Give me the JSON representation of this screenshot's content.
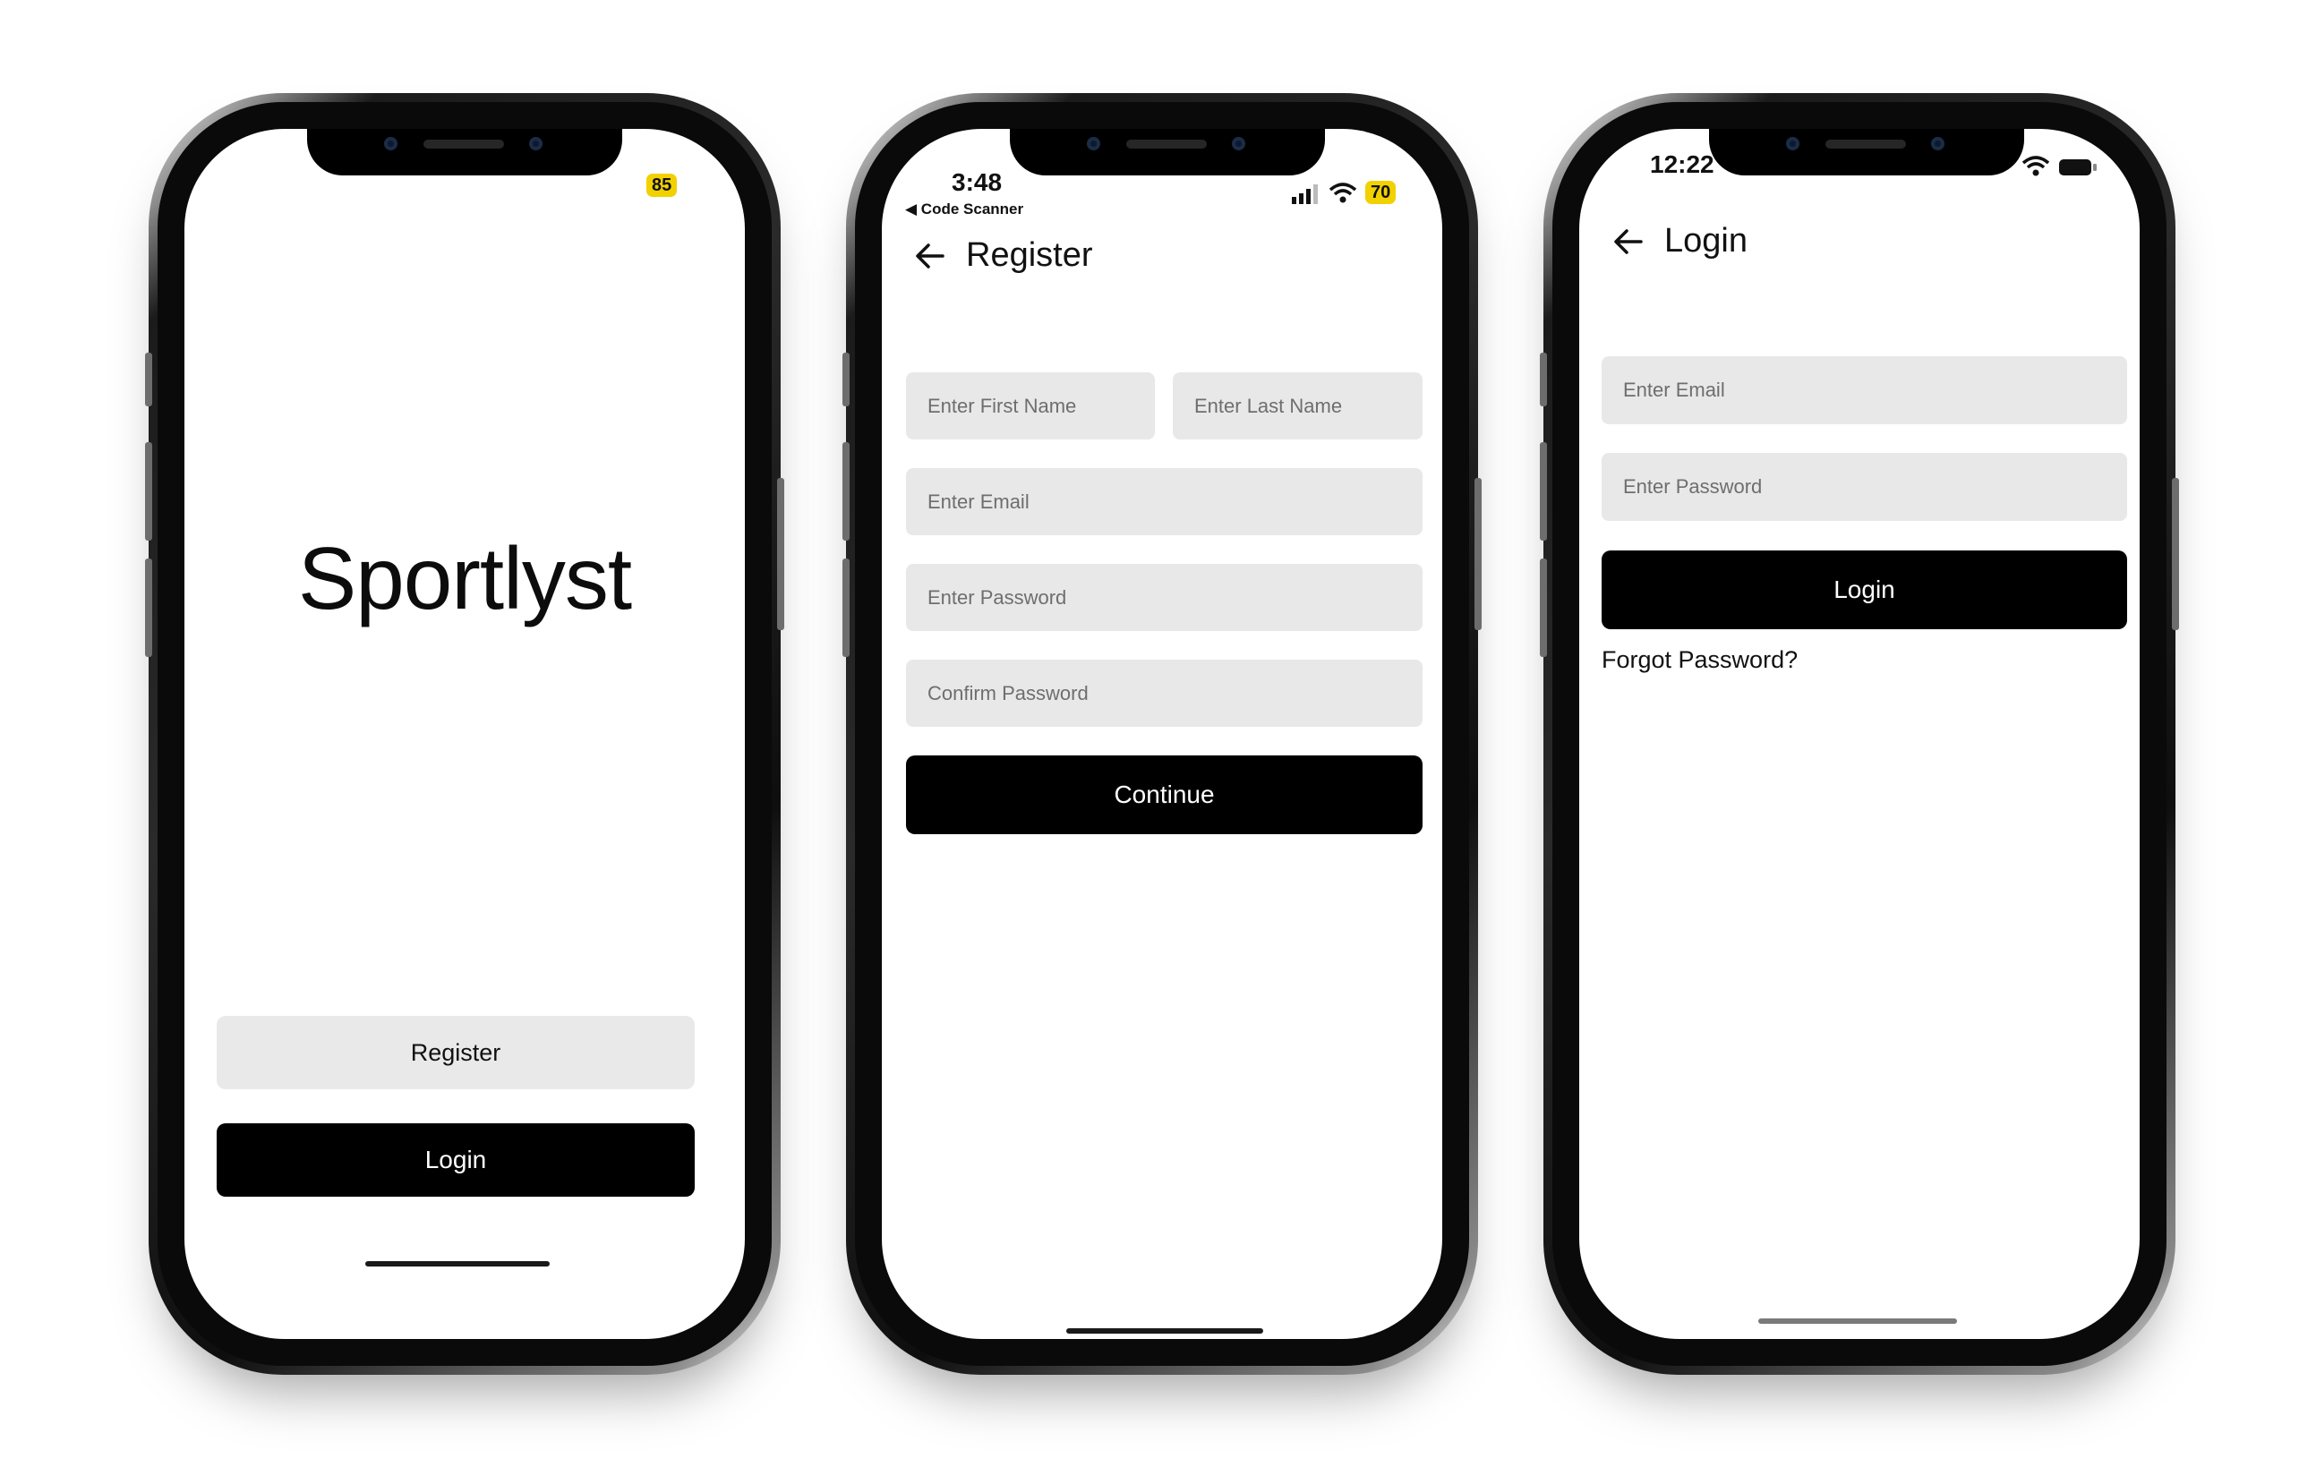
{
  "screens": {
    "splash": {
      "battery": "85",
      "brand": "Sportlyst",
      "register_label": "Register",
      "login_label": "Login"
    },
    "register": {
      "time": "3:48",
      "back_app": "◀ Code Scanner",
      "battery": "70",
      "title": "Register",
      "first_name_placeholder": "Enter First Name",
      "last_name_placeholder": "Enter Last Name",
      "email_placeholder": "Enter Email",
      "password_placeholder": "Enter Password",
      "confirm_password_placeholder": "Confirm Password",
      "continue_label": "Continue"
    },
    "login": {
      "time": "12:22",
      "title": "Login",
      "email_placeholder": "Enter Email",
      "password_placeholder": "Enter Password",
      "login_label": "Login",
      "forgot_label": "Forgot Password?"
    }
  },
  "icons": [
    "back-arrow-icon",
    "wifi-icon",
    "cellular-signal-icon",
    "battery-icon"
  ],
  "colors": {
    "primary": "#000000",
    "field_bg": "#e8e8e8",
    "battery_badge": "#f2d100",
    "background": "#ffffff"
  }
}
